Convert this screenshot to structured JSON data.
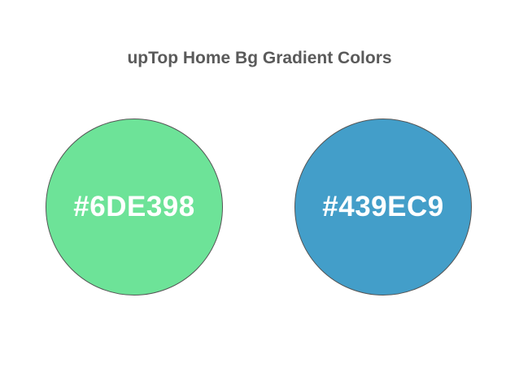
{
  "title": "upTop Home Bg Gradient Colors",
  "swatches": [
    {
      "label": "#6DE398",
      "color": "#6DE398"
    },
    {
      "label": "#439EC9",
      "color": "#439EC9"
    }
  ]
}
